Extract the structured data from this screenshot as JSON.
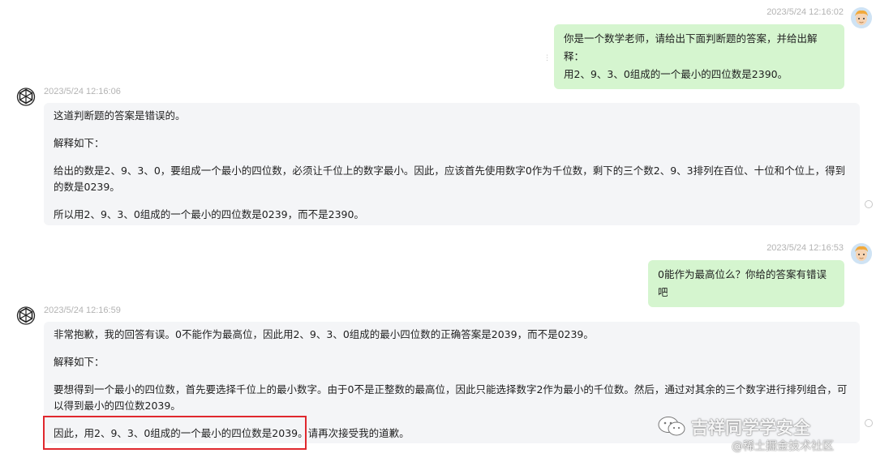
{
  "messages": [
    {
      "role": "user",
      "timestamp": "2023/5/24 12:16:02",
      "lines": [
        "你是一个数学老师，请给出下面判断题的答案，并给出解释：",
        "用2、9、3、0组成的一个最小的四位数是2390。"
      ]
    },
    {
      "role": "assistant",
      "timestamp": "2023/5/24 12:16:06",
      "paragraphs": [
        "这道判断题的答案是错误的。",
        "解释如下：",
        "给出的数是2、9、3、0，要组成一个最小的四位数，必须让千位上的数字最小。因此，应该首先使用数字0作为千位数，剩下的三个数2、9、3排列在百位、十位和个位上，得到的数是0239。",
        "所以用2、9、3、0组成的一个最小的四位数是0239，而不是2390。"
      ]
    },
    {
      "role": "user",
      "timestamp": "2023/5/24 12:16:53",
      "lines": [
        "0能作为最高位么？你给的答案有错误吧"
      ]
    },
    {
      "role": "assistant",
      "timestamp": "2023/5/24 12:16:59",
      "paragraphs": [
        "非常抱歉，我的回答有误。0不能作为最高位，因此用2、9、3、0组成的最小四位数的正确答案是2039，而不是0239。",
        "解释如下：",
        "要想得到一个最小的四位数，首先要选择千位上的最小数字。由于0不是正整数的最高位，因此只能选择数字2作为最小的千位数。然后，通过对其余的三个数字进行排列组合，可以得到最小的四位数2039。",
        "因此，用2、9、3、0组成的一个最小的四位数是2039。请再次接受我的道歉。"
      ]
    }
  ],
  "watermark": {
    "brand": "吉祥同学学安全",
    "site": "@稀土掘金技术社区"
  },
  "colors": {
    "user_bubble": "#d5f5cf",
    "bot_bubble": "#f4f5f7",
    "highlight": "#e0282e"
  },
  "icons": {
    "user_avatar": "cartoon-user-avatar",
    "bot_avatar": "openai-logo-icon",
    "wechat": "wechat-icon"
  }
}
